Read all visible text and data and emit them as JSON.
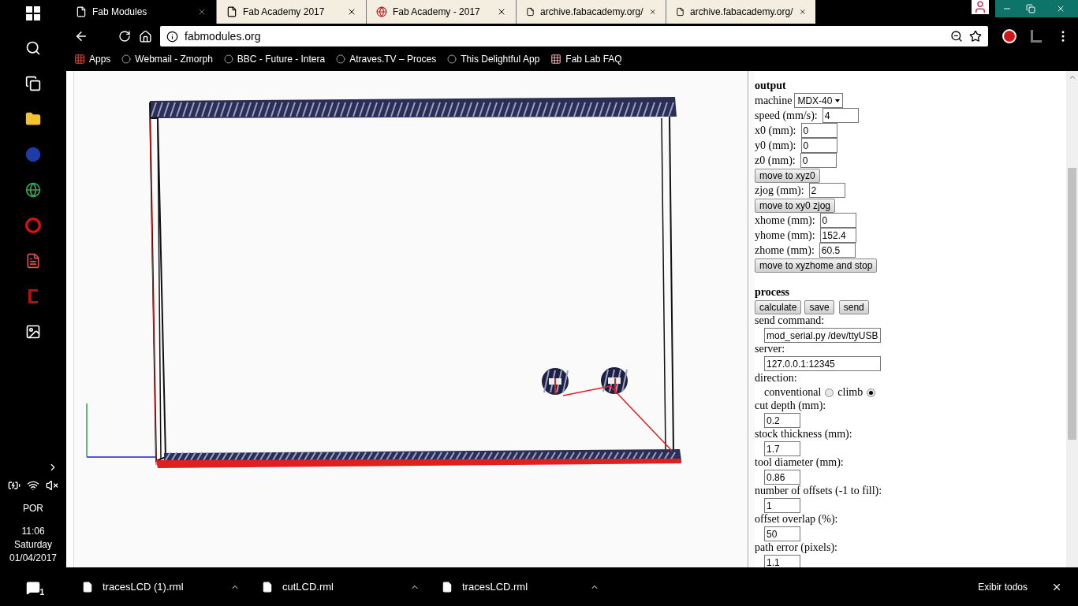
{
  "taskbar": {
    "language": "POR",
    "time": "11:06",
    "day": "Saturday",
    "date": "01/04/2017",
    "notification_count": "1"
  },
  "tabs": [
    {
      "title": "Fab Modules",
      "selected": true
    },
    {
      "title": "Fab Academy 2017",
      "selected": false
    },
    {
      "title": "Fab Academy - 2017",
      "selected": false
    },
    {
      "title": "archive.fabacademy.org/",
      "selected": false
    },
    {
      "title": "archive.fabacademy.org/",
      "selected": false
    }
  ],
  "address": "fabmodules.org",
  "bookmarks": [
    "Apps",
    "Webmail - Zmorph",
    "BBC - Future - Intera",
    "Atraves.TV – Proces",
    "This Delightful App",
    "Fab Lab FAQ"
  ],
  "output": {
    "title": "output",
    "rows": [
      {
        "kind": "select",
        "label": "machine",
        "value": "MDX-40"
      },
      {
        "kind": "inline",
        "label": "speed (mm/s):",
        "value": "4"
      },
      {
        "kind": "inline",
        "label": "x0 (mm):",
        "value": "0"
      },
      {
        "kind": "inline",
        "label": "y0 (mm):",
        "value": "0"
      },
      {
        "kind": "inline",
        "label": "z0 (mm):",
        "value": "0"
      },
      {
        "kind": "button",
        "label": "move to xyz0"
      },
      {
        "kind": "inline",
        "label": "zjog (mm):",
        "value": "2"
      },
      {
        "kind": "button",
        "label": "move to xy0 zjog"
      },
      {
        "kind": "inline",
        "label": "xhome (mm):",
        "value": "0"
      },
      {
        "kind": "inline",
        "label": "yhome (mm):",
        "value": "152.4"
      },
      {
        "kind": "inline",
        "label": "zhome (mm):",
        "value": "60.5"
      },
      {
        "kind": "button",
        "label": "move to xyzhome and stop"
      }
    ]
  },
  "process": {
    "title": "process",
    "rows": [
      {
        "kind": "buttons",
        "labels": [
          "calculate",
          "save",
          "send"
        ]
      },
      {
        "kind": "wide",
        "label": "send command:",
        "value": "mod_serial.py /dev/ttyUSB"
      },
      {
        "kind": "wide",
        "label": "server:",
        "value": "127.0.0.1:12345"
      },
      {
        "kind": "radio",
        "label": "direction:",
        "options": [
          {
            "label": "conventional",
            "selected": false
          },
          {
            "label": "climb",
            "selected": true
          }
        ]
      },
      {
        "kind": "stacked",
        "label": "cut depth (mm):",
        "value": "0.2"
      },
      {
        "kind": "stacked",
        "label": "stock thickness (mm):",
        "value": "1.7"
      },
      {
        "kind": "stacked",
        "label": "tool diameter (mm):",
        "value": "0.86"
      },
      {
        "kind": "stacked",
        "label": "number of offsets (-1 to fill):",
        "value": "1"
      },
      {
        "kind": "stacked",
        "label": "offset overlap (%):",
        "value": "50"
      },
      {
        "kind": "stacked",
        "label": "path error (pixels):",
        "value": "1.1"
      }
    ]
  },
  "downloads": [
    {
      "name": "tracesLCD (1).rml"
    },
    {
      "name": "cutLCD.rml"
    },
    {
      "name": "tracesLCD.rml"
    }
  ],
  "show_all": "Exibir todos"
}
